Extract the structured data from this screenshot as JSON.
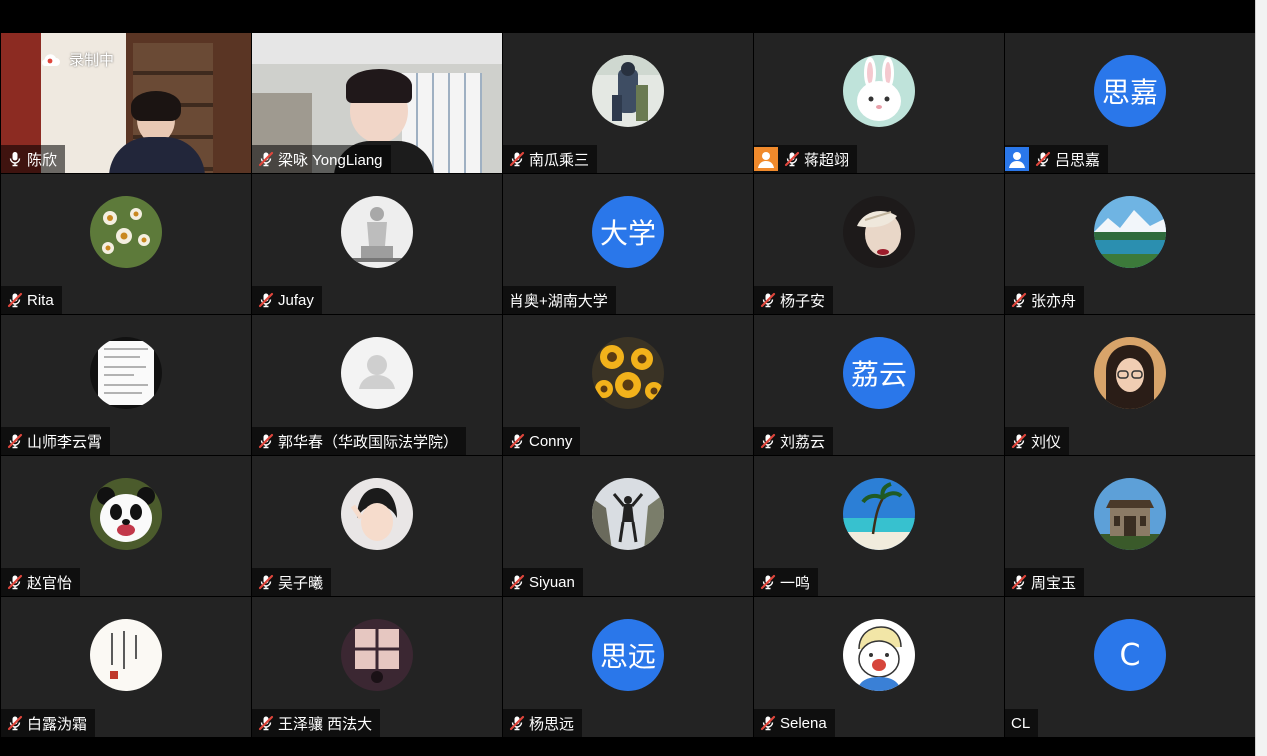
{
  "recording_label": "录制中",
  "colors": {
    "avatar_blue": "#2a77ea",
    "badge_orange": "#f08a2c",
    "badge_blue": "#2a77ea",
    "tile_bg": "#232323"
  },
  "participants": [
    {
      "name": "陈欣",
      "video": true,
      "audio": "on"
    },
    {
      "name": "梁咏 YongLiang",
      "video": true,
      "audio": "muted"
    },
    {
      "name": "南瓜乘三",
      "avatar": "photo-person-icon",
      "audio": "muted"
    },
    {
      "name": "蒋超翊",
      "avatar": "photo-bunny-icon",
      "audio": "muted",
      "badge": "host-orange-icon"
    },
    {
      "name": "吕思嘉",
      "avatar_text": "思嘉",
      "audio": "muted",
      "badge": "cohost-blue-icon"
    },
    {
      "name": "Rita",
      "avatar": "photo-flowers-icon",
      "audio": "muted"
    },
    {
      "name": "Jufay",
      "avatar": "photo-statue-icon",
      "audio": "muted"
    },
    {
      "name": "肖奥+湖南大学",
      "avatar_text": "大学",
      "audio": "none"
    },
    {
      "name": "杨子安",
      "avatar": "photo-mask-icon",
      "audio": "muted"
    },
    {
      "name": "张亦舟",
      "avatar": "photo-lake-icon",
      "audio": "muted"
    },
    {
      "name": "山师李云霄",
      "avatar": "photo-document-icon",
      "audio": "muted"
    },
    {
      "name": "郭华春（华政国际法学院）",
      "avatar": "default-user-icon",
      "audio": "muted"
    },
    {
      "name": "Conny",
      "avatar": "photo-sunflowers-icon",
      "audio": "muted"
    },
    {
      "name": "刘荔云",
      "avatar_text": "荔云",
      "audio": "muted"
    },
    {
      "name": "刘仪",
      "avatar": "photo-girl-icon",
      "audio": "muted"
    },
    {
      "name": "赵官怡",
      "avatar": "photo-panda-icon",
      "audio": "muted"
    },
    {
      "name": "吴子曦",
      "avatar": "photo-boy-icon",
      "audio": "muted"
    },
    {
      "name": "Siyuan",
      "avatar": "photo-hiker-icon",
      "audio": "muted"
    },
    {
      "name": "一鸣",
      "avatar": "photo-beach-icon",
      "audio": "muted"
    },
    {
      "name": "周宝玉",
      "avatar": "photo-gate-icon",
      "audio": "muted"
    },
    {
      "name": "白露沩霜",
      "avatar": "photo-calligraphy-icon",
      "audio": "muted"
    },
    {
      "name": "王泽骧 西法大",
      "avatar": "photo-window-icon",
      "audio": "muted"
    },
    {
      "name": "杨思远",
      "avatar_text": "思远",
      "audio": "muted"
    },
    {
      "name": "Selena",
      "avatar": "photo-cartoon-icon",
      "audio": "muted"
    },
    {
      "name": "CL",
      "avatar_text": "C",
      "audio": "none"
    }
  ]
}
